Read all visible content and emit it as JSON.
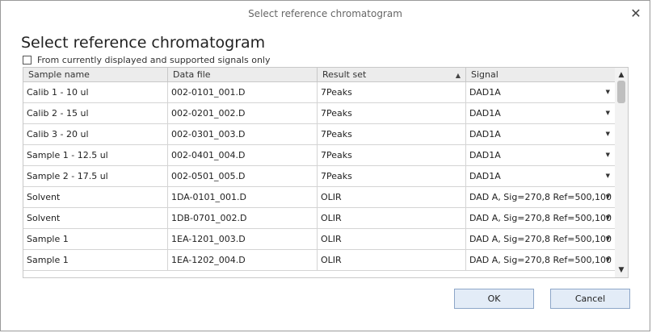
{
  "window": {
    "title": "Select reference chromatogram"
  },
  "heading": "Select reference chromatogram",
  "filter": {
    "label": "From currently displayed and supported signals only",
    "checked": false
  },
  "table": {
    "columns": [
      "Sample name",
      "Data file",
      "Result set",
      "Signal"
    ],
    "rows": [
      {
        "sample": "Calib 1 - 10 ul",
        "file": "002-0101_001.D",
        "result": "7Peaks",
        "signal": "DAD1A"
      },
      {
        "sample": "Calib 2 - 15 ul",
        "file": "002-0201_002.D",
        "result": "7Peaks",
        "signal": "DAD1A"
      },
      {
        "sample": "Calib 3 - 20 ul",
        "file": "002-0301_003.D",
        "result": "7Peaks",
        "signal": "DAD1A"
      },
      {
        "sample": "Sample 1 - 12.5 ul",
        "file": "002-0401_004.D",
        "result": "7Peaks",
        "signal": "DAD1A"
      },
      {
        "sample": "Sample 2 - 17.5 ul",
        "file": "002-0501_005.D",
        "result": "7Peaks",
        "signal": "DAD1A"
      },
      {
        "sample": "Solvent",
        "file": "1DA-0101_001.D",
        "result": "OLIR",
        "signal": "DAD A, Sig=270,8 Ref=500,100"
      },
      {
        "sample": "Solvent",
        "file": "1DB-0701_002.D",
        "result": "OLIR",
        "signal": "DAD A, Sig=270,8 Ref=500,100"
      },
      {
        "sample": "Sample 1",
        "file": "1EA-1201_003.D",
        "result": "OLIR",
        "signal": "DAD A, Sig=270,8 Ref=500,100"
      },
      {
        "sample": "Sample 1",
        "file": "1EA-1202_004.D",
        "result": "OLIR",
        "signal": "DAD A, Sig=270,8 Ref=500,100"
      }
    ]
  },
  "buttons": {
    "ok": "OK",
    "cancel": "Cancel"
  }
}
